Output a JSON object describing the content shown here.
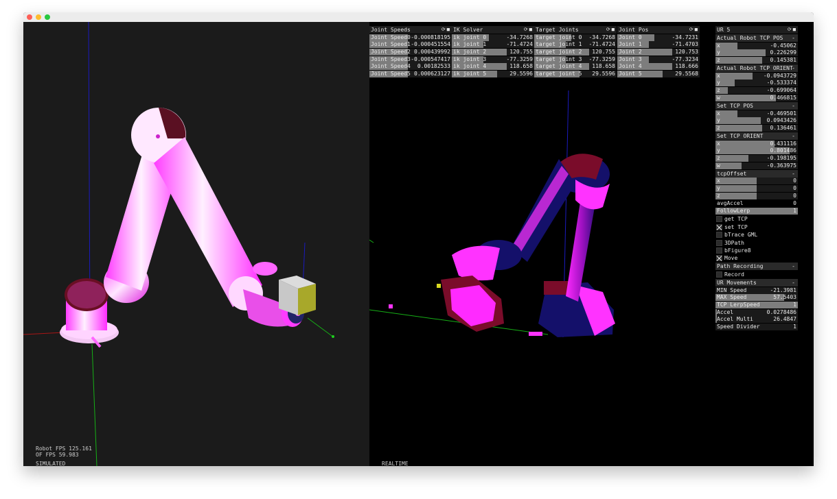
{
  "overlays": {
    "robot_fps": "Robot FPS 125.161",
    "of_fps": "OF FPS 59.983",
    "left_mode": "SIMULATED",
    "right_mode": "REALTIME"
  },
  "panels": {
    "joint_speeds": {
      "title": "Joint Speeds",
      "rows": [
        {
          "label": "Joint Speed0",
          "value": "-0.000818195",
          "fill": 0.5
        },
        {
          "label": "Joint Speed1",
          "value": "-0.000451554",
          "fill": 0.5
        },
        {
          "label": "Joint Speed2",
          "value": "0.000439992",
          "fill": 0.5
        },
        {
          "label": "Joint Speed3",
          "value": "-0.000547417",
          "fill": 0.5
        },
        {
          "label": "Joint Speed4",
          "value": "0.00182533",
          "fill": 0.5
        },
        {
          "label": "Joint Speed5",
          "value": "0.000623127",
          "fill": 0.5
        }
      ]
    },
    "ik_solver": {
      "title": "IK Solver",
      "rows": [
        {
          "label": "ik joint 0",
          "value": "-34.7268",
          "fill": 0.45
        },
        {
          "label": "ik joint 1",
          "value": "-71.4724",
          "fill": 0.38
        },
        {
          "label": "ik joint 2",
          "value": "120.755",
          "fill": 0.67
        },
        {
          "label": "ik joint 3",
          "value": "-77.3259",
          "fill": 0.38
        },
        {
          "label": "ik joint 4",
          "value": "118.658",
          "fill": 0.67
        },
        {
          "label": "ik joint 5",
          "value": "29.5596",
          "fill": 0.55
        }
      ]
    },
    "target_joints": {
      "title": "Target Joints",
      "rows": [
        {
          "label": "target joint 0",
          "value": "-34.7268",
          "fill": 0.45
        },
        {
          "label": "target joint 1",
          "value": "-71.4724",
          "fill": 0.38
        },
        {
          "label": "target joint 2",
          "value": "120.755",
          "fill": 0.67
        },
        {
          "label": "target joint 3",
          "value": "-77.3259",
          "fill": 0.38
        },
        {
          "label": "target joint 4",
          "value": "118.658",
          "fill": 0.67
        },
        {
          "label": "target joint 5",
          "value": "29.5596",
          "fill": 0.55
        }
      ]
    },
    "joint_pos": {
      "title": "Joint Pos",
      "rows": [
        {
          "label": "Joint 0",
          "value": "-34.7231",
          "fill": 0.45
        },
        {
          "label": "Joint 1",
          "value": "-71.4703",
          "fill": 0.38
        },
        {
          "label": "Joint 2",
          "value": "120.753",
          "fill": 0.67
        },
        {
          "label": "Joint 3",
          "value": "-77.3234",
          "fill": 0.38
        },
        {
          "label": "Joint 4",
          "value": "118.666",
          "fill": 0.67
        },
        {
          "label": "Joint 5",
          "value": "29.5568",
          "fill": 0.55
        }
      ]
    },
    "ur5": {
      "title": "UR 5",
      "actual_tcp_pos": {
        "title": "Actual Robot TCP POS",
        "rows": [
          {
            "label": "x",
            "value": "-0.45062",
            "fill": 0.27
          },
          {
            "label": "y",
            "value": "0.226299",
            "fill": 0.61
          },
          {
            "label": "z",
            "value": "0.145381",
            "fill": 0.57
          }
        ]
      },
      "actual_tcp_orient": {
        "title": "Actual Robot TCP ORIENT",
        "rows": [
          {
            "label": "x",
            "value": "-0.0943729",
            "fill": 0.45
          },
          {
            "label": "y",
            "value": "-0.533374",
            "fill": 0.23
          },
          {
            "label": "z",
            "value": "-0.699064",
            "fill": 0.15
          },
          {
            "label": "w",
            "value": "0.466815",
            "fill": 0.73
          }
        ]
      },
      "set_tcp_pos": {
        "title": "Set TCP POS",
        "rows": [
          {
            "label": "x",
            "value": "-0.469501",
            "fill": 0.27
          },
          {
            "label": "y",
            "value": "0.0943426",
            "fill": 0.55
          },
          {
            "label": "z",
            "value": "0.136461",
            "fill": 0.57
          }
        ]
      },
      "set_tcp_orient": {
        "title": "Set TCP ORIENT",
        "rows": [
          {
            "label": "x",
            "value": "0.431116",
            "fill": 0.72
          },
          {
            "label": "y",
            "value": "0.801486",
            "fill": 0.9
          },
          {
            "label": "z",
            "value": "-0.198195",
            "fill": 0.4
          },
          {
            "label": "w",
            "value": "-0.363975",
            "fill": 0.32
          }
        ]
      },
      "tcp_offset": {
        "title": "tcpOffset",
        "rows": [
          {
            "label": "x",
            "value": "0",
            "fill": 0.5
          },
          {
            "label": "y",
            "value": "0",
            "fill": 0.5
          },
          {
            "label": "z",
            "value": "0",
            "fill": 0.5
          }
        ]
      },
      "avg_accel": {
        "label": "avgAccel",
        "value": "0"
      },
      "follow_lerp": {
        "label": "FollowLerp",
        "value": "1",
        "fill": 1.0
      },
      "toggles": [
        {
          "label": "get TCP",
          "checked": false
        },
        {
          "label": "set TCP",
          "checked": true
        },
        {
          "label": "bTrace GML",
          "checked": false
        },
        {
          "label": "3DPath",
          "checked": false
        },
        {
          "label": "bFigure8",
          "checked": false
        },
        {
          "label": "Move",
          "checked": true
        }
      ],
      "path_recording": {
        "title": "Path Recording",
        "record_label": "Record",
        "record_checked": false
      },
      "ur_movements": {
        "title": "UR Movements",
        "rows": [
          {
            "label": "MIN Speed",
            "value": "-21.3981",
            "fill": 0.0
          },
          {
            "label": "MAX Speed",
            "value": "57.5403",
            "fill": 0.83
          },
          {
            "label": "TCP LerpSpeed",
            "value": "1",
            "fill": 1.0
          },
          {
            "label": "Accel",
            "value": "0.0278486",
            "fill": 0.02
          },
          {
            "label": "Accel Multi",
            "value": "26.4847",
            "fill": 0.02
          },
          {
            "label": "Speed Divider",
            "value": "1",
            "fill": 0.0
          }
        ]
      }
    }
  },
  "colors": {
    "magenta": "#ff33ff",
    "navy": "#14106a",
    "maroon": "#7a0c2a",
    "slider_fill": "#7d7d7d"
  }
}
